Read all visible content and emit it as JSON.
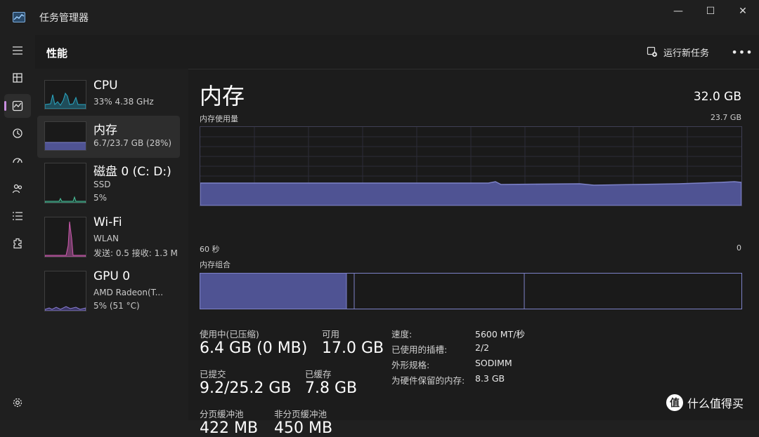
{
  "window": {
    "title": "任务管理器",
    "minimize": "—",
    "maximize": "☐",
    "close": "✕"
  },
  "nav": {
    "menu_icon": "hamburger-icon",
    "items": [
      {
        "name": "processes",
        "icon": "processes-icon",
        "active": false
      },
      {
        "name": "performance",
        "icon": "performance-icon",
        "active": true
      },
      {
        "name": "app-history",
        "icon": "history-icon",
        "active": false
      },
      {
        "name": "startup",
        "icon": "startup-icon",
        "active": false
      },
      {
        "name": "users",
        "icon": "users-icon",
        "active": false
      },
      {
        "name": "details",
        "icon": "details-icon",
        "active": false
      },
      {
        "name": "services",
        "icon": "services-icon",
        "active": false
      }
    ],
    "settings_icon": "gear-icon"
  },
  "header": {
    "title": "性能",
    "run_task": "运行新任务",
    "more": "•••"
  },
  "sidebar": {
    "items": [
      {
        "name": "CPU",
        "line1": "33% 4.38 GHz",
        "line2": "",
        "color": "#2aa7c2"
      },
      {
        "name": "内存",
        "line1": "6.7/23.7 GB (28%)",
        "line2": "",
        "color": "#6a74d6"
      },
      {
        "name": "磁盘 0 (C: D:)",
        "line1": "SSD",
        "line2": "5%",
        "color": "#4bbf9a"
      },
      {
        "name": "Wi-Fi",
        "line1": "WLAN",
        "line2": "发送: 0.5 接收: 1.3 M",
        "color": "#d05bb0"
      },
      {
        "name": "GPU 0",
        "line1": "AMD Radeon(T...",
        "line2": "5% (51 °C)",
        "color": "#8c7fd6"
      }
    ]
  },
  "memory": {
    "title": "内存",
    "total": "32.0 GB",
    "usage_label": "内存使用量",
    "usage_max": "23.7 GB",
    "time_left": "60 秒",
    "time_right": "0",
    "composition_label": "内存组合",
    "in_use_label": "使用中(已压缩)",
    "in_use_value": "6.4 GB (0 MB)",
    "available_label": "可用",
    "available_value": "17.0 GB",
    "committed_label": "已提交",
    "committed_value": "9.2/25.2 GB",
    "cached_label": "已缓存",
    "cached_value": "7.8 GB",
    "paged_label": "分页缓冲池",
    "paged_value": "422 MB",
    "nonpaged_label": "非分页缓冲池",
    "nonpaged_value": "450 MB",
    "specs": [
      {
        "k": "速度:",
        "v": "5600 MT/秒"
      },
      {
        "k": "已使用的插槽:",
        "v": "2/2"
      },
      {
        "k": "外形规格:",
        "v": "SODIMM"
      },
      {
        "k": "为硬件保留的内存:",
        "v": "8.3 GB"
      }
    ],
    "usage_fraction": 0.27,
    "composition_in_use_fraction": 0.27
  },
  "watermark": {
    "logo": "值",
    "text": "什么值得买"
  },
  "colors": {
    "accent": "#c98ee0",
    "memory_fill": "#4f5393",
    "memory_line": "#7d82c8"
  }
}
